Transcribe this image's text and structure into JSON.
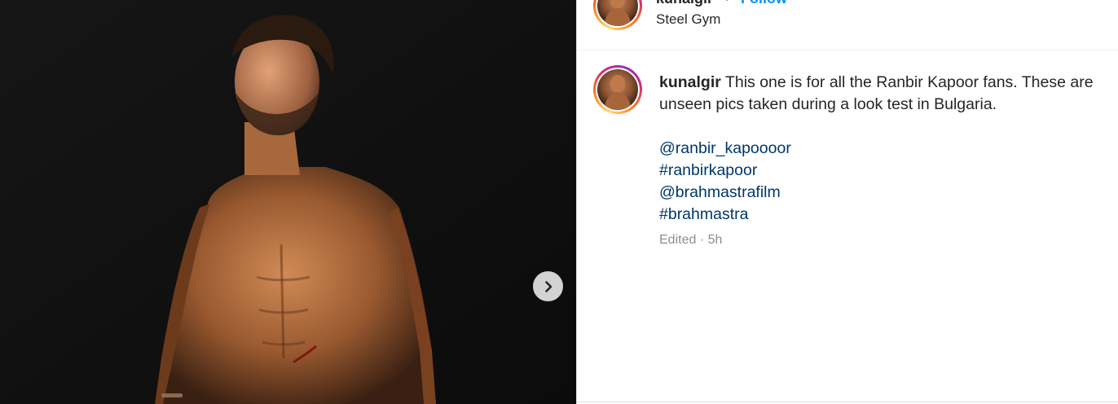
{
  "post": {
    "media": {
      "next_icon": "chevron-right-icon",
      "background": "#000000"
    },
    "header": {
      "username": "kunalgir",
      "separator": "•",
      "follow_label": "Follow",
      "location": "Steel Gym"
    },
    "caption": {
      "username": "kunalgir",
      "text": "This one is for all the Ranbir Kapoor fans. These are unseen pics taken during a look test in Bulgaria.",
      "tags": [
        "@ranbir_kapoooor",
        "#ranbirkapoor",
        "@brahmastrafilm",
        "#brahmastra"
      ],
      "edited_label": "Edited",
      "meta_separator": "·",
      "time_ago": "5h"
    }
  },
  "colors": {
    "link": "#00376b",
    "follow": "#0095f6",
    "muted": "#8e8e8e",
    "text": "#262626"
  }
}
